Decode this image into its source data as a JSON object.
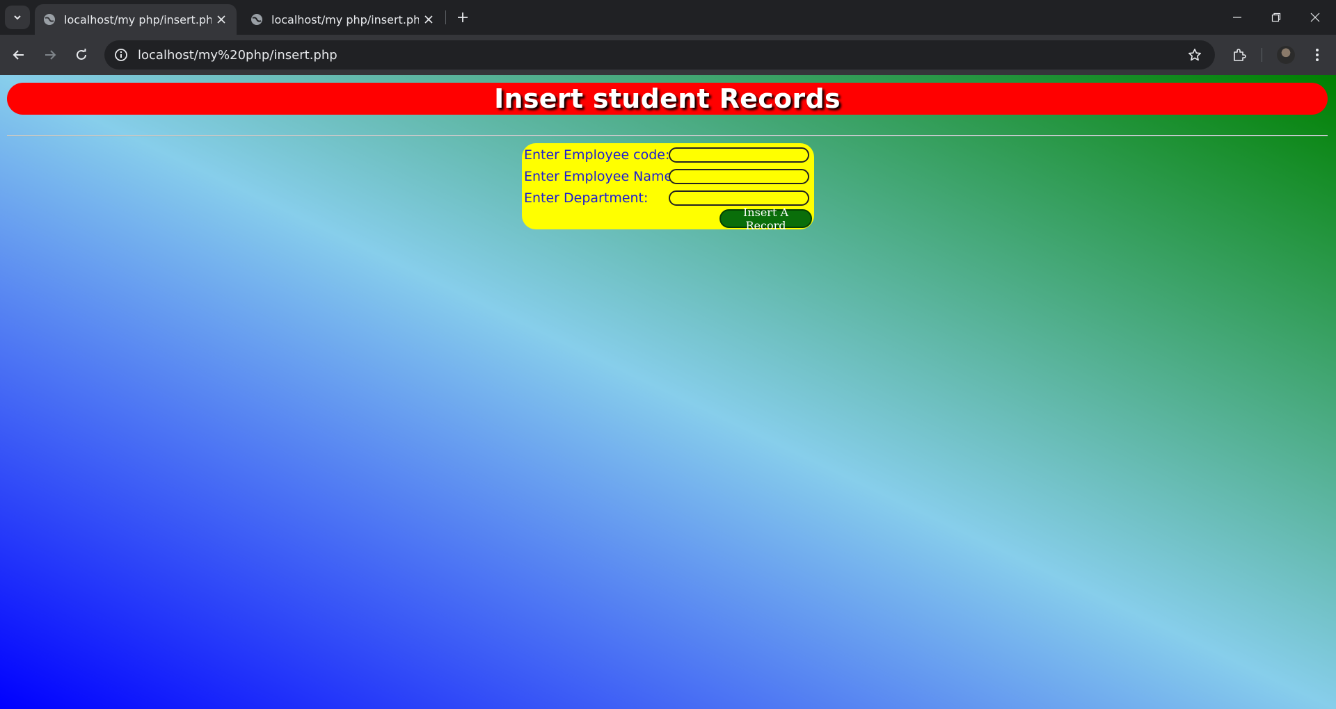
{
  "browser": {
    "tabs": [
      {
        "title": "localhost/my php/insert.php",
        "active": true
      },
      {
        "title": "localhost/my php/insert.php",
        "active": false
      }
    ],
    "url": "localhost/my%20php/insert.php"
  },
  "page": {
    "heading": "Insert student Records",
    "form": {
      "fields": [
        {
          "label": "Enter Employee code:",
          "value": "",
          "placeholder": ""
        },
        {
          "label": "Enter Employee Name:",
          "value": "",
          "placeholder": ""
        },
        {
          "label": "Enter Department:",
          "value": "",
          "placeholder": ""
        }
      ],
      "submit_label": "Insert A Record"
    },
    "colors": {
      "banner": "#ff0000",
      "form_background": "#ffff00",
      "label_text": "#1b1bd6",
      "button": "#0a6e0a",
      "gradient": [
        "#0000ff",
        "#87ceeb",
        "#008000"
      ]
    }
  }
}
